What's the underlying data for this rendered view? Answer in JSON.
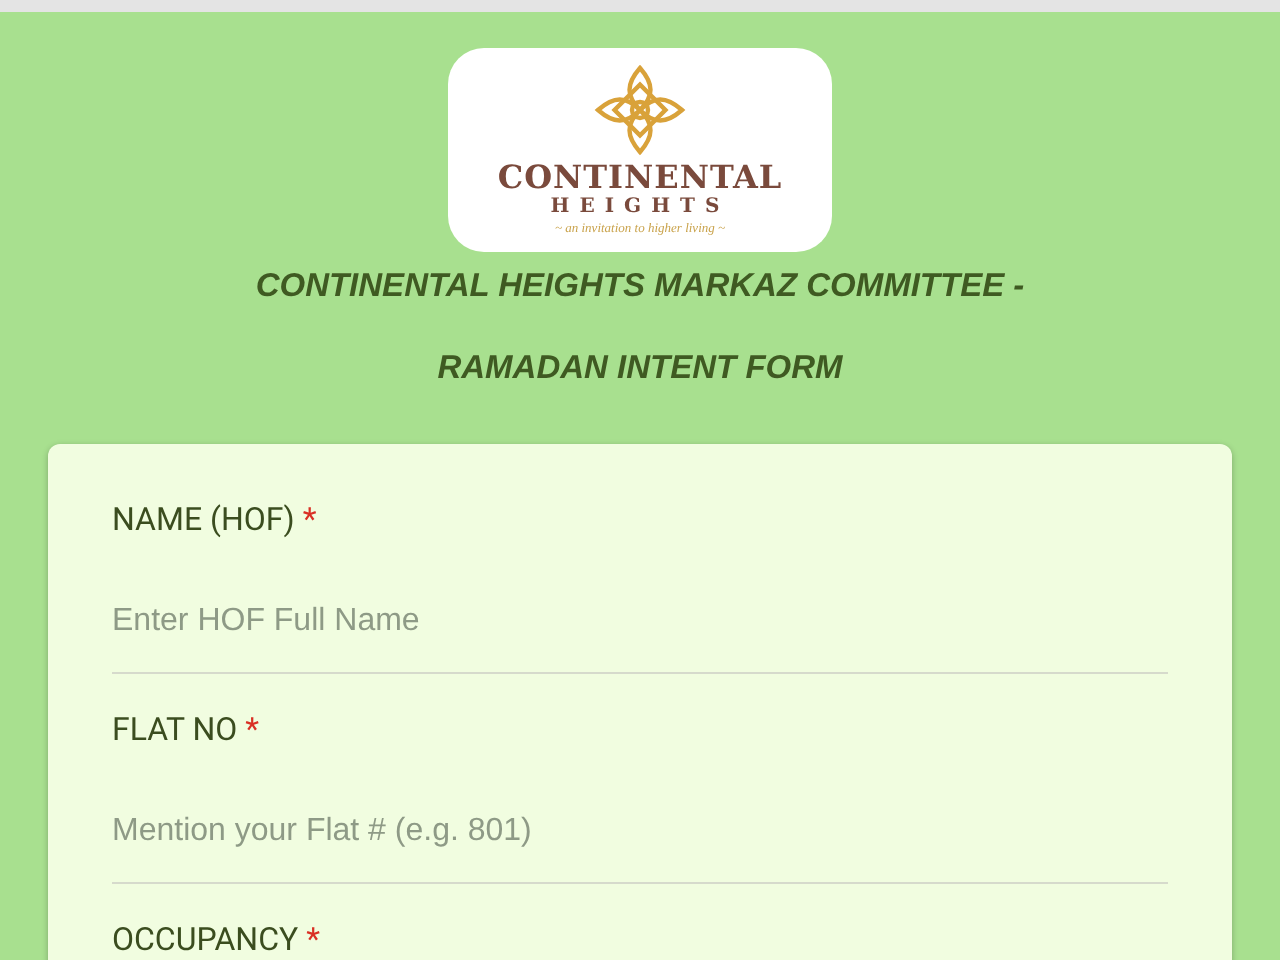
{
  "logo": {
    "name": "CONTINENTAL",
    "subname": "HEIGHTS",
    "tagline": "~ an invitation to higher living ~"
  },
  "title_lines": [
    "CONTINENTAL HEIGHTS MARKAZ COMMITTEE -",
    "RAMADAN INTENT FORM"
  ],
  "fields": [
    {
      "label": "NAME (HOF)",
      "required_mark": "*",
      "placeholder": "Enter HOF Full Name"
    },
    {
      "label": "FLAT NO",
      "required_mark": "*",
      "placeholder": "Mention your Flat # (e.g. 801)"
    },
    {
      "label": "OCCUPANCY",
      "required_mark": "*"
    }
  ]
}
